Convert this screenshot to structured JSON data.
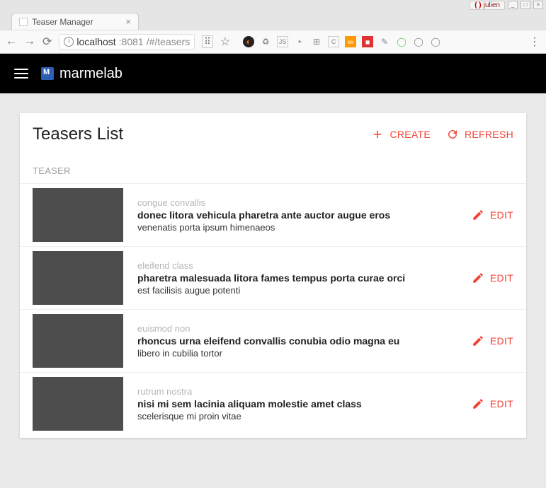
{
  "os": {
    "user": "julien"
  },
  "browser": {
    "tab_title": "Teaser Manager",
    "url_host": "localhost",
    "url_port": ":8081",
    "url_path": "/#/teasers"
  },
  "app": {
    "brand": "marmelab"
  },
  "content": {
    "title": "Teasers List",
    "actions": {
      "create": "CREATE",
      "refresh": "REFRESH",
      "edit": "EDIT"
    },
    "column_label": "TEASER",
    "rows": [
      {
        "kicker": "congue convallis",
        "title": "donec litora vehicula pharetra ante auctor augue eros",
        "sub": "venenatis porta ipsum himenaeos"
      },
      {
        "kicker": "eleifend class",
        "title": "pharetra malesuada litora fames tempus porta curae orci",
        "sub": "est facilisis augue potenti"
      },
      {
        "kicker": "euismod non",
        "title": "rhoncus urna eleifend convallis conubia odio magna eu",
        "sub": "libero in cubilia tortor"
      },
      {
        "kicker": "rutrum nostra",
        "title": "nisi mi sem lacinia aliquam molestie amet class",
        "sub": "scelerisque mi proin vitae"
      }
    ]
  }
}
